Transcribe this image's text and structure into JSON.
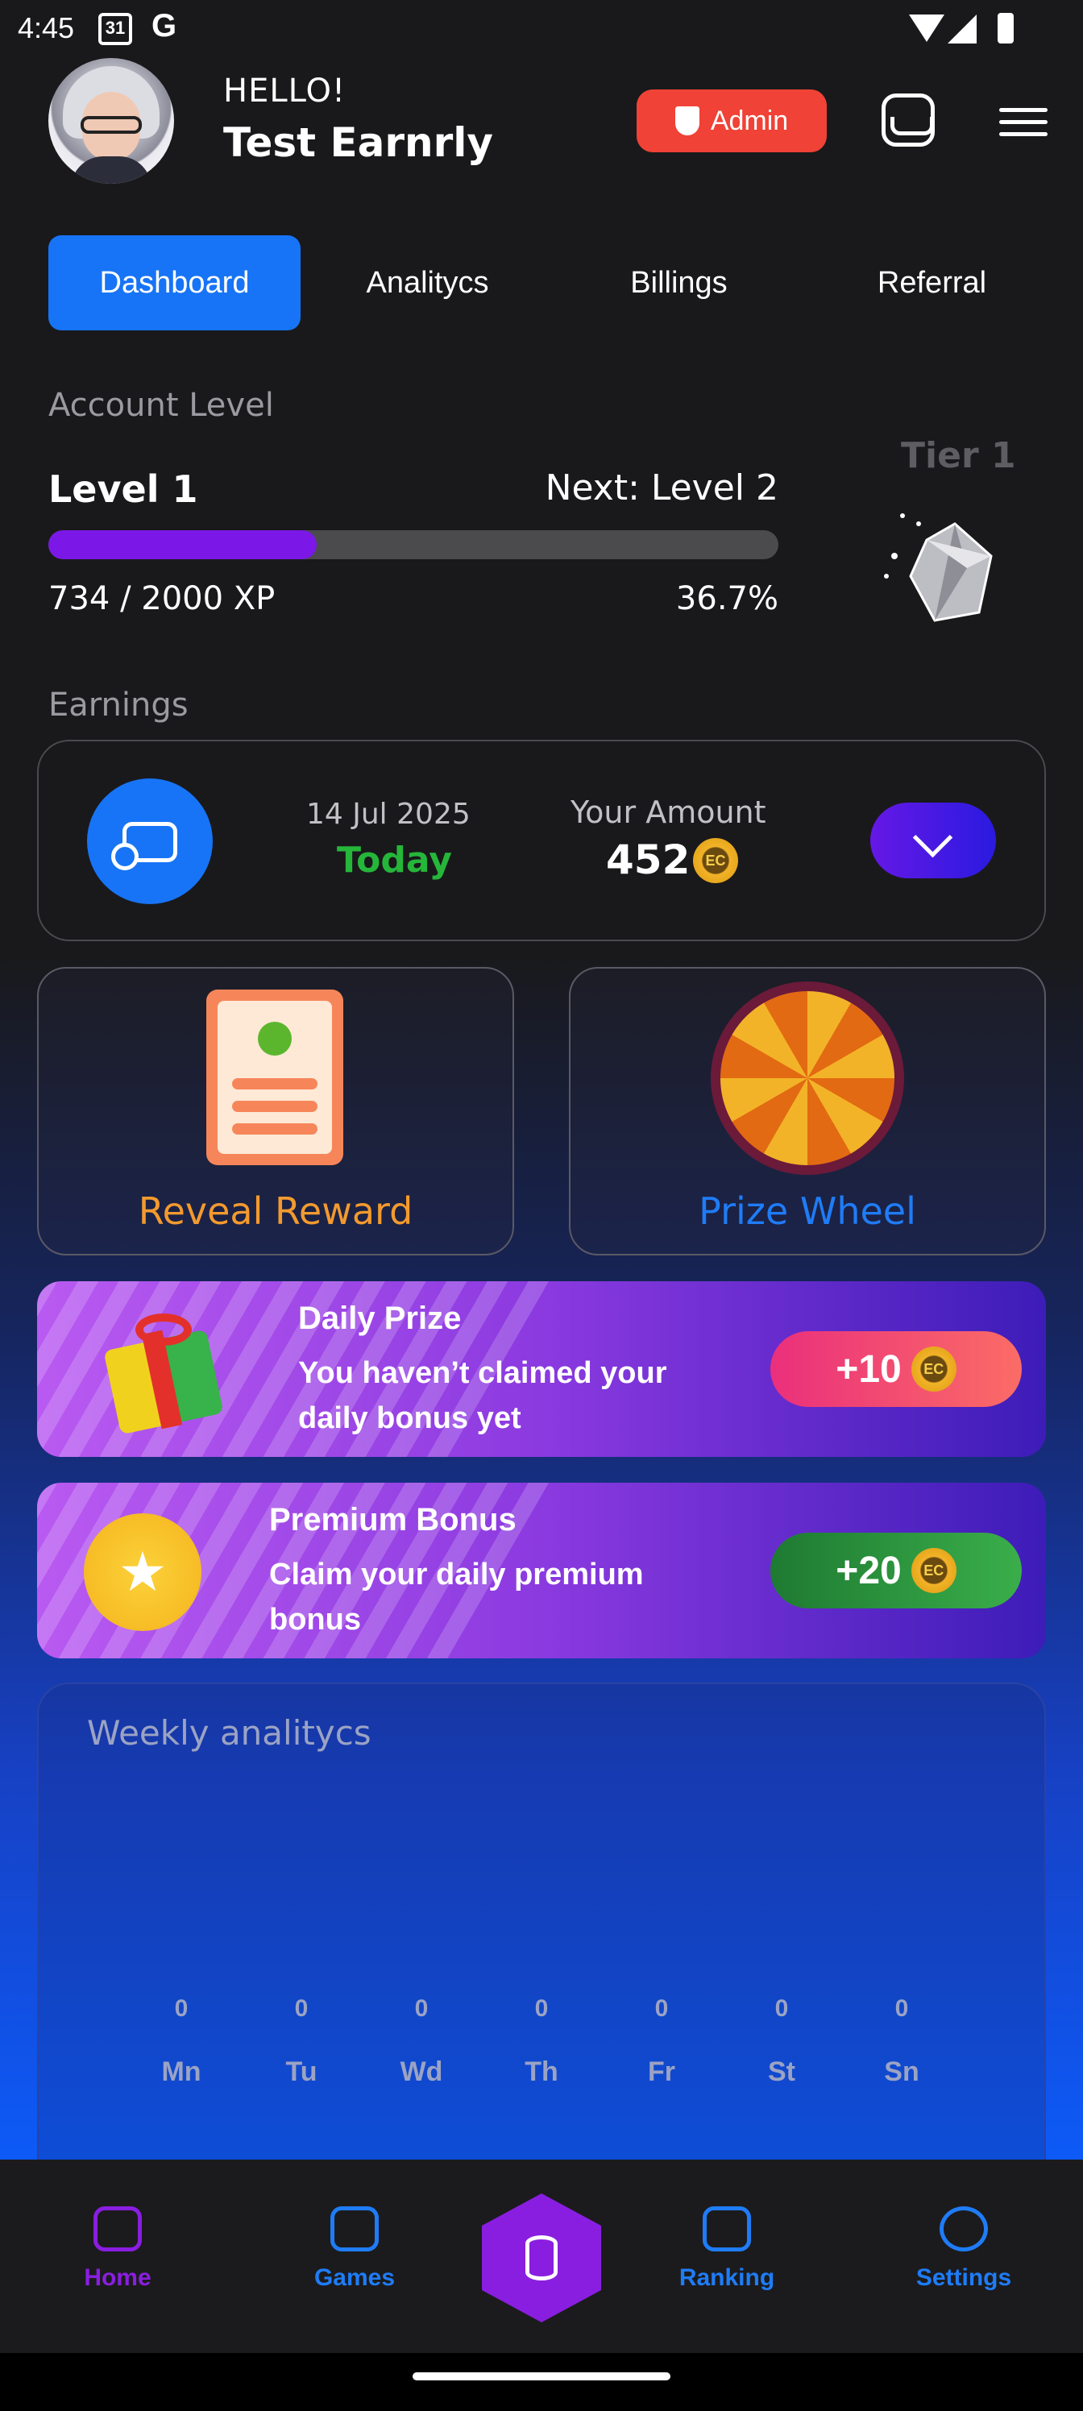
{
  "status_bar": {
    "time": "4:45",
    "calendar_day": "31",
    "google": "G"
  },
  "header": {
    "greeting": "HELLO!",
    "user_name": "Test Earnrly",
    "admin_label": "Admin"
  },
  "tabs": [
    {
      "label": "Dashboard",
      "active": true
    },
    {
      "label": "Analitycs",
      "active": false
    },
    {
      "label": "Billings",
      "active": false
    },
    {
      "label": "Referral",
      "active": false
    }
  ],
  "account_level": {
    "section_title": "Account Level",
    "level": "Level 1",
    "next_level": "Next: Level 2",
    "xp_text": "734 / 2000 XP",
    "percent_text": "36.7%",
    "progress_fraction": 0.367,
    "tier": "Tier 1"
  },
  "earnings": {
    "section_title": "Earnings",
    "date": "14 Jul 2025",
    "day_label": "Today",
    "amount_label": "Your Amount",
    "amount": "452",
    "coin_label": "EC"
  },
  "reward_cards": {
    "reveal": "Reveal Reward",
    "wheel": "Prize Wheel"
  },
  "daily_prize": {
    "title": "Daily Prize",
    "line1": "You haven’t claimed your",
    "line2": "daily bonus yet",
    "reward": "+10",
    "coin_label": "EC"
  },
  "premium_bonus": {
    "title": "Premium Bonus",
    "line1": "Claim your daily premium",
    "line2": "bonus",
    "reward": "+20",
    "coin_label": "EC"
  },
  "weekly": {
    "title": "Weekly analitycs",
    "days": [
      "Mn",
      "Tu",
      "Wd",
      "Th",
      "Fr",
      "St",
      "Sn"
    ],
    "values": [
      "0",
      "0",
      "0",
      "0",
      "0",
      "0",
      "0"
    ]
  },
  "nav": {
    "home": "Home",
    "games": "Games",
    "ranking": "Ranking",
    "settings": "Settings"
  },
  "colors": {
    "accent_blue": "#1774f6",
    "purple": "#7b18e7",
    "admin_red": "#f04236",
    "today_green": "#25b63a",
    "orange_text": "#f39a2e",
    "nav_purple": "#8a1ee0"
  }
}
